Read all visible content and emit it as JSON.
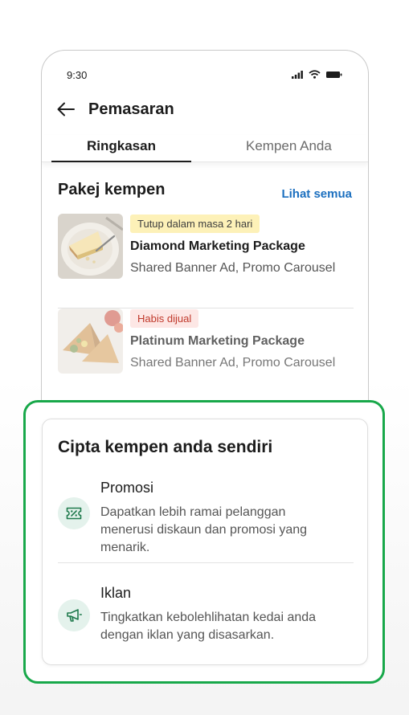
{
  "status_bar": {
    "time": "9:30",
    "icons": [
      "signal-icon",
      "wifi-icon",
      "battery-icon"
    ]
  },
  "header": {
    "title": "Pemasaran",
    "back_icon": "arrow-left-icon"
  },
  "tabs": [
    {
      "label": "Ringkasan",
      "active": true
    },
    {
      "label": "Kempen Anda",
      "active": false
    }
  ],
  "packages_section": {
    "title": "Pakej kempen",
    "see_all": "Lihat semua",
    "items": [
      {
        "badge": "Tutup dalam masa 2 hari",
        "badge_color": "#fdf1b8",
        "name": "Diamond Marketing Package",
        "desc": "Shared Banner Ad, Promo Carousel",
        "image": "cheesecake-dessert-image"
      },
      {
        "badge": "Habis dijual",
        "badge_color": "#fde7e5",
        "name": "Platinum Marketing Package",
        "desc": "Shared Banner Ad, Promo Carousel",
        "image": "samosa-image",
        "faded": true
      }
    ]
  },
  "create_card": {
    "title": "Cipta kempen anda sendiri",
    "options": [
      {
        "title": "Promosi",
        "desc": "Dapatkan lebih ramai pelanggan menerusi diskaun dan promosi yang menarik.",
        "icon": "discount-ticket-icon"
      },
      {
        "title": "Iklan",
        "desc": "Tingkatkan kebolehlihatan kedai anda dengan iklan yang disasarkan.",
        "icon": "megaphone-icon"
      }
    ]
  },
  "colors": {
    "accent_green": "#18a84a",
    "link_blue": "#1b6fbf",
    "icon_green": "#1f7a4d"
  }
}
